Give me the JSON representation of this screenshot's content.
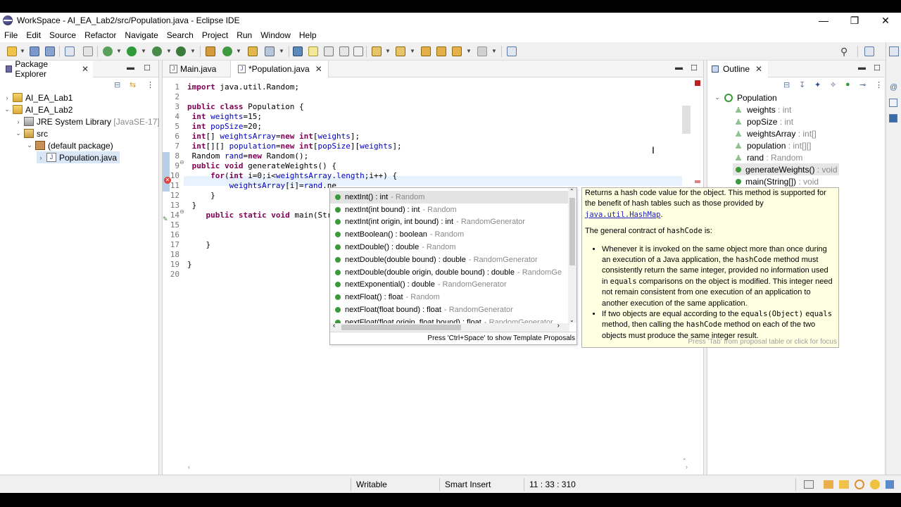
{
  "window": {
    "title": "WorkSpace - AI_EA_Lab2/src/Population.java - Eclipse IDE",
    "minimize": "—",
    "maximize": "❐",
    "close": "✕"
  },
  "menu": [
    "File",
    "Edit",
    "Source",
    "Refactor",
    "Navigate",
    "Search",
    "Project",
    "Run",
    "Window",
    "Help"
  ],
  "package_explorer": {
    "title": "Package Explorer",
    "items": [
      {
        "label": "AI_EA_Lab1",
        "extra": ""
      },
      {
        "label": "AI_EA_Lab2",
        "extra": ""
      },
      {
        "label": "JRE System Library",
        "extra": "[JavaSE-17]"
      },
      {
        "label": "src",
        "extra": ""
      },
      {
        "label": "(default package)",
        "extra": ""
      },
      {
        "label": "Population.java",
        "extra": ""
      }
    ]
  },
  "editor": {
    "tabs": [
      {
        "label": "Main.java"
      },
      {
        "label": "*Population.java"
      }
    ],
    "lines": [
      {
        "n": "1",
        "html": "<span class=\"kw\">import</span> java.util.Random;"
      },
      {
        "n": "2",
        "html": ""
      },
      {
        "n": "3",
        "html": "<span class=\"kw\">public class</span> Population {"
      },
      {
        "n": "4",
        "html": " <span class=\"kw\">int</span> <span class=\"fld\">weights</span>=15;"
      },
      {
        "n": "5",
        "html": " <span class=\"kw\">int</span> <span class=\"fld\">popSize</span>=20;"
      },
      {
        "n": "6",
        "html": " <span class=\"kw\">int</span>[] <span class=\"fld\">weightsArray</span>=<span class=\"kw\">new int</span>[<span class=\"fld\">weights</span>];"
      },
      {
        "n": "7",
        "html": " <span class=\"kw\">int</span>[][] <span class=\"fld\">population</span>=<span class=\"kw\">new int</span>[<span class=\"fld\">popSize</span>][<span class=\"fld\">weights</span>];"
      },
      {
        "n": "8",
        "html": " Random <span class=\"fld\">rand</span>=<span class=\"kw\">new</span> Random();"
      },
      {
        "n": "9",
        "html": " <span class=\"kw\">public void</span> generateWeights() {"
      },
      {
        "n": "10",
        "html": "     <span class=\"kw\">for</span>(<span class=\"kw\">int</span> i=0;i&lt;<span class=\"fld\">weightsArray</span>.<span class=\"fld\">length</span>;i++) {"
      },
      {
        "n": "11",
        "html": "         <span class=\"fld\">weightsArray</span>[i]=<span class=\"fld\">rand</span>.ne"
      },
      {
        "n": "12",
        "html": "     }"
      },
      {
        "n": "13",
        "html": " }"
      },
      {
        "n": "14",
        "html": "    <span class=\"kw\">public static void</span> main(Str"
      },
      {
        "n": "15",
        "html": ""
      },
      {
        "n": "16",
        "html": ""
      },
      {
        "n": "17",
        "html": "    }"
      },
      {
        "n": "18",
        "html": ""
      },
      {
        "n": "19",
        "html": "}"
      },
      {
        "n": "20",
        "html": ""
      }
    ]
  },
  "outline": {
    "title": "Outline",
    "root": "Population",
    "items": [
      {
        "name": "weights",
        "type": " : int",
        "kind": "field"
      },
      {
        "name": "popSize",
        "type": " : int",
        "kind": "field"
      },
      {
        "name": "weightsArray",
        "type": " : int[]",
        "kind": "field"
      },
      {
        "name": "population",
        "type": " : int[][]",
        "kind": "field"
      },
      {
        "name": "rand",
        "type": " : Random",
        "kind": "field"
      },
      {
        "name": "generateWeights()",
        "type": " : void",
        "kind": "method"
      },
      {
        "name": "main(String[])",
        "type": " : void",
        "kind": "method"
      }
    ]
  },
  "assist": {
    "items": [
      {
        "name": "nextInt()",
        "ret": " : int",
        "owner": "- Random"
      },
      {
        "name": "nextInt(int bound)",
        "ret": " : int",
        "owner": "- Random"
      },
      {
        "name": "nextInt(int origin, int bound)",
        "ret": " : int",
        "owner": "- RandomGenerator"
      },
      {
        "name": "nextBoolean()",
        "ret": " : boolean",
        "owner": "- Random"
      },
      {
        "name": "nextDouble()",
        "ret": " : double",
        "owner": "- Random"
      },
      {
        "name": "nextDouble(double bound)",
        "ret": " : double",
        "owner": "- RandomGenerator"
      },
      {
        "name": "nextDouble(double origin, double bound)",
        "ret": " : double",
        "owner": "- RandomGe"
      },
      {
        "name": "nextExponential()",
        "ret": " : double",
        "owner": "- RandomGenerator"
      },
      {
        "name": "nextFloat()",
        "ret": " : float",
        "owner": "- Random"
      },
      {
        "name": "nextFloat(float bound)",
        "ret": " : float",
        "owner": "- RandomGenerator"
      },
      {
        "name": "nextFloat(float origin, float bound)",
        "ret": " : float",
        "owner": "- RandomGenerator"
      }
    ],
    "footer": "Press 'Ctrl+Space' to show Template Proposals"
  },
  "doc": {
    "p1_a": "Returns a hash code value for the object. This method is supported for the benefit of hash tables such as those provided by ",
    "p1_link": "java.util.HashMap",
    "p1_b": ".",
    "p2_a": "The general contract of ",
    "p2_code": "hashCode",
    "p2_b": " is:",
    "li1_a": "Whenever it is invoked on the same object more than once during an execution of a Java application, the ",
    "li1_code1": "hashCode",
    "li1_b": " method must consistently return the same integer, provided no information used in ",
    "li1_code2": "equals",
    "li1_c": " comparisons on the object is modified. This integer need not remain consistent from one execution of an application to another execution of the same application.",
    "li2_a": "If two objects are equal according to the ",
    "li2_code1": "equals(Object)",
    "li2_code2": "equals",
    "li2_b": " method, then calling the ",
    "li2_code3": "hashCode",
    "li2_c": " method on each of the two objects must produce the same integer result.",
    "footer": "Press 'Tab' from proposal table or click for focus"
  },
  "status": {
    "writable": "Writable",
    "insert_mode": "Smart Insert",
    "position": "11 : 33 : 310"
  }
}
